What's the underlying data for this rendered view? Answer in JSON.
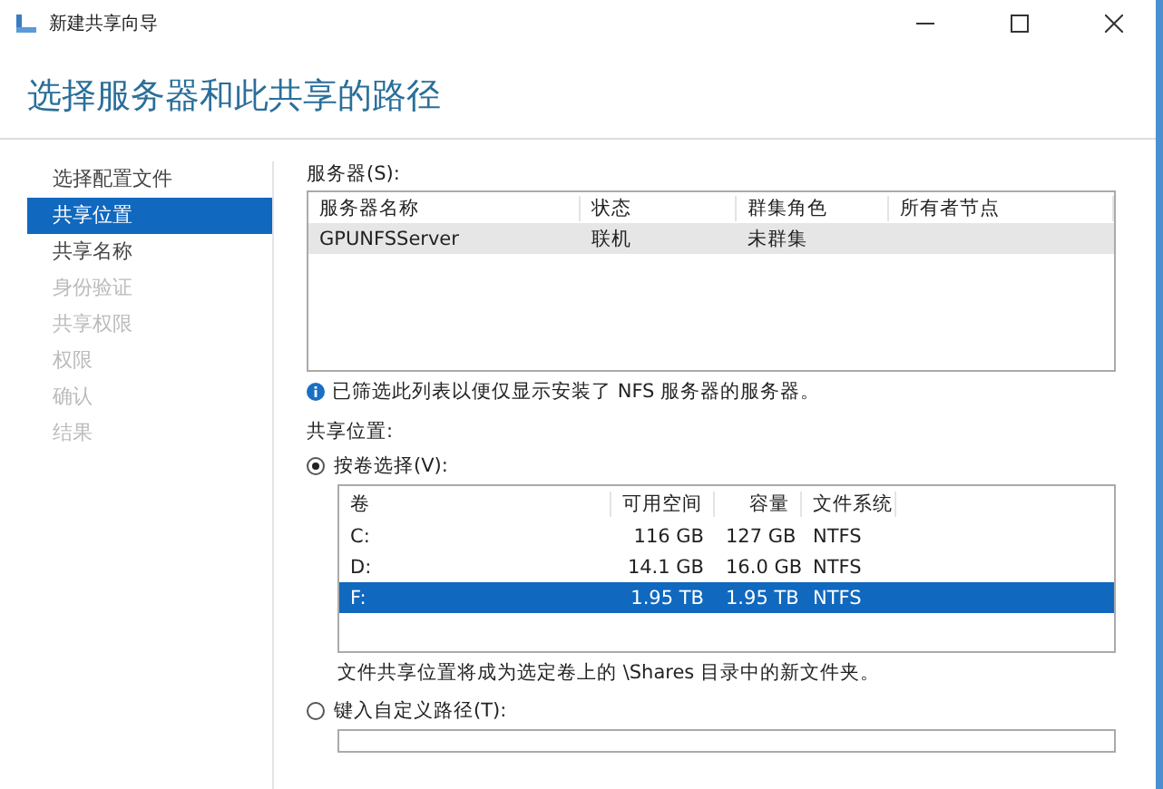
{
  "window": {
    "title": "新建共享向导"
  },
  "heading": "选择服务器和此共享的路径",
  "nav": [
    {
      "label": "选择配置文件",
      "selected": false,
      "disabled": false
    },
    {
      "label": "共享位置",
      "selected": true,
      "disabled": false
    },
    {
      "label": "共享名称",
      "selected": false,
      "disabled": false
    },
    {
      "label": "身份验证",
      "selected": false,
      "disabled": true
    },
    {
      "label": "共享权限",
      "selected": false,
      "disabled": true
    },
    {
      "label": "权限",
      "selected": false,
      "disabled": true
    },
    {
      "label": "确认",
      "selected": false,
      "disabled": true
    },
    {
      "label": "结果",
      "selected": false,
      "disabled": true
    }
  ],
  "servers": {
    "label": "服务器(S):",
    "columns": [
      "服务器名称",
      "状态",
      "群集角色",
      "所有者节点"
    ],
    "rows": [
      {
        "cells": [
          "GPUNFSServer",
          "联机",
          "未群集",
          ""
        ],
        "selected": true
      }
    ]
  },
  "info": "已筛选此列表以便仅显示安装了 NFS 服务器的服务器。",
  "location_label": "共享位置:",
  "by_volume": {
    "label": "按卷选择(V):",
    "selected": true
  },
  "volumes": {
    "columns": [
      "卷",
      "可用空间",
      "容量",
      "文件系统"
    ],
    "rows": [
      {
        "cells": [
          "C:",
          "116 GB",
          "127 GB",
          "NTFS"
        ],
        "selected": false
      },
      {
        "cells": [
          "D:",
          "14.1 GB",
          "16.0 GB",
          "NTFS"
        ],
        "selected": false
      },
      {
        "cells": [
          "F:",
          "1.95 TB",
          "1.95 TB",
          "NTFS"
        ],
        "selected": true
      }
    ]
  },
  "volume_note": "文件共享位置将成为选定卷上的 \\Shares 目录中的新文件夹。",
  "custom_path": {
    "label": "键入自定义路径(T):",
    "selected": false
  }
}
